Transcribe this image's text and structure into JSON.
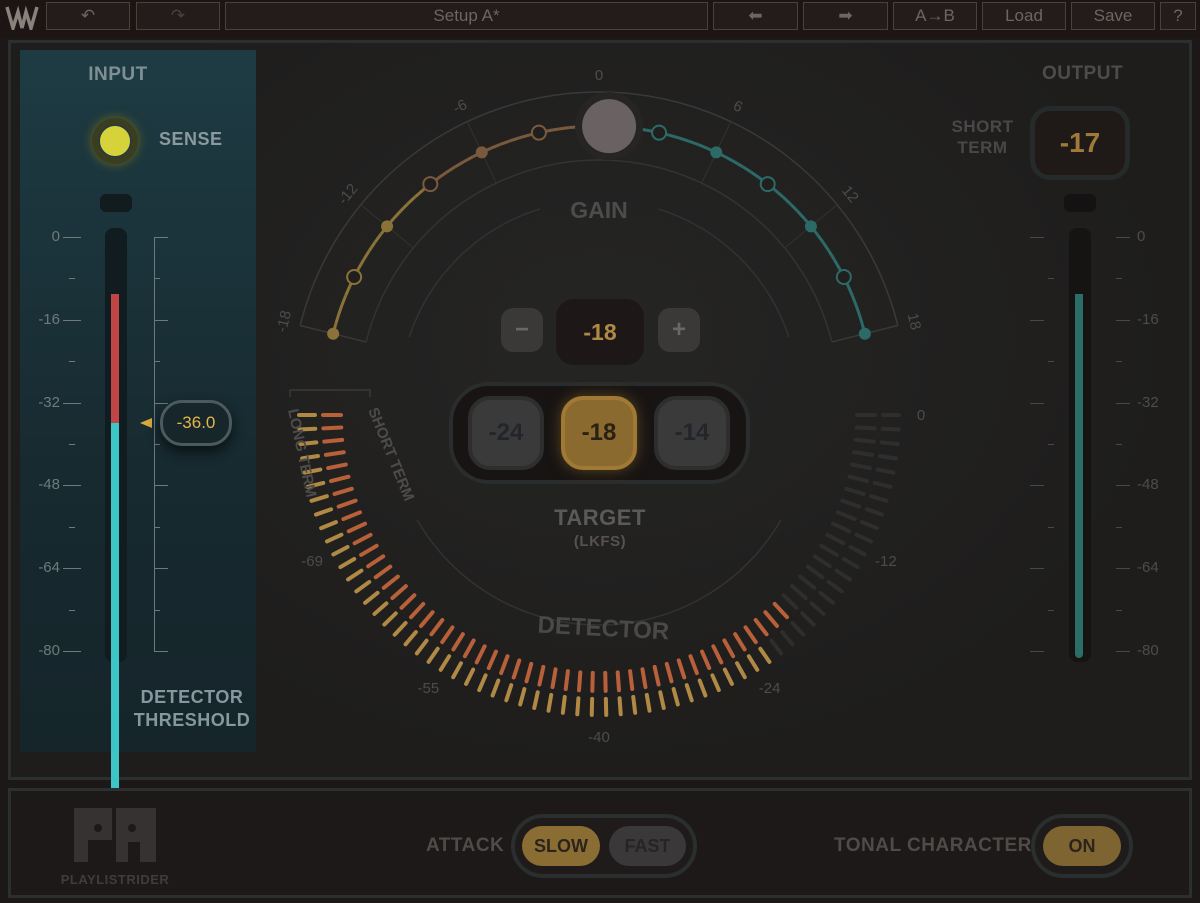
{
  "toolbar": {
    "logo_icon": "waves-logo",
    "undo_icon": "undo-icon",
    "redo_icon": "redo-icon",
    "preset_name": "Setup A*",
    "prev_icon": "arrow-left-icon",
    "next_icon": "arrow-right-icon",
    "compare_label": "A→B",
    "load_label": "Load",
    "save_label": "Save",
    "help_label": "?"
  },
  "input": {
    "title": "INPUT",
    "sense_label": "SENSE",
    "sense_on": true,
    "scale": [
      "0",
      "-16",
      "-32",
      "-48",
      "-64",
      "-80"
    ],
    "meter_level_db": -11,
    "threshold_db": -36,
    "threshold_display": "-36.0",
    "threshold_label_1": "DETECTOR",
    "threshold_label_2": "THRESHOLD"
  },
  "gain": {
    "title": "GAIN",
    "scale": [
      "-18",
      "-12",
      "-6",
      "0",
      "6",
      "12",
      "18"
    ],
    "current_db": 0.5
  },
  "target": {
    "value": "-18",
    "minus_label": "−",
    "plus_label": "+",
    "presets": [
      "-24",
      "-18",
      "-14"
    ],
    "selected": "-18",
    "title": "TARGET",
    "unit": "(LKFS)"
  },
  "detector": {
    "title": "DETECTOR",
    "long_term_label": "LONG TERM",
    "short_term_label": "SHORT TERM",
    "scale": [
      "-69",
      "-55",
      "-40",
      "-24",
      "-12",
      "0"
    ],
    "short_term_db": -19,
    "long_term_db": -22
  },
  "output": {
    "title": "OUTPUT",
    "short_term_label_1": "SHORT",
    "short_term_label_2": "TERM",
    "short_term_value": "-17",
    "scale": [
      "0",
      "-16",
      "-32",
      "-48",
      "-64",
      "-80"
    ],
    "meter_level_db": -11
  },
  "footer": {
    "product_name": "PLAYLISTRIDER",
    "logo_icon": "pr-logo",
    "attack_label": "ATTACK",
    "attack_options": [
      "SLOW",
      "FAST"
    ],
    "attack_selected": "SLOW",
    "tonal_label": "TONAL CHARACTER",
    "tonal_value": "ON"
  },
  "colors": {
    "accent_gold": "#c49a3c",
    "short_term": "#b8603a",
    "long_term": "#b08a45",
    "input_meter": "#3ec6c6",
    "input_over": "#c04646",
    "gain_teal": "#2c7878",
    "sense_led": "#e6dc3a"
  }
}
